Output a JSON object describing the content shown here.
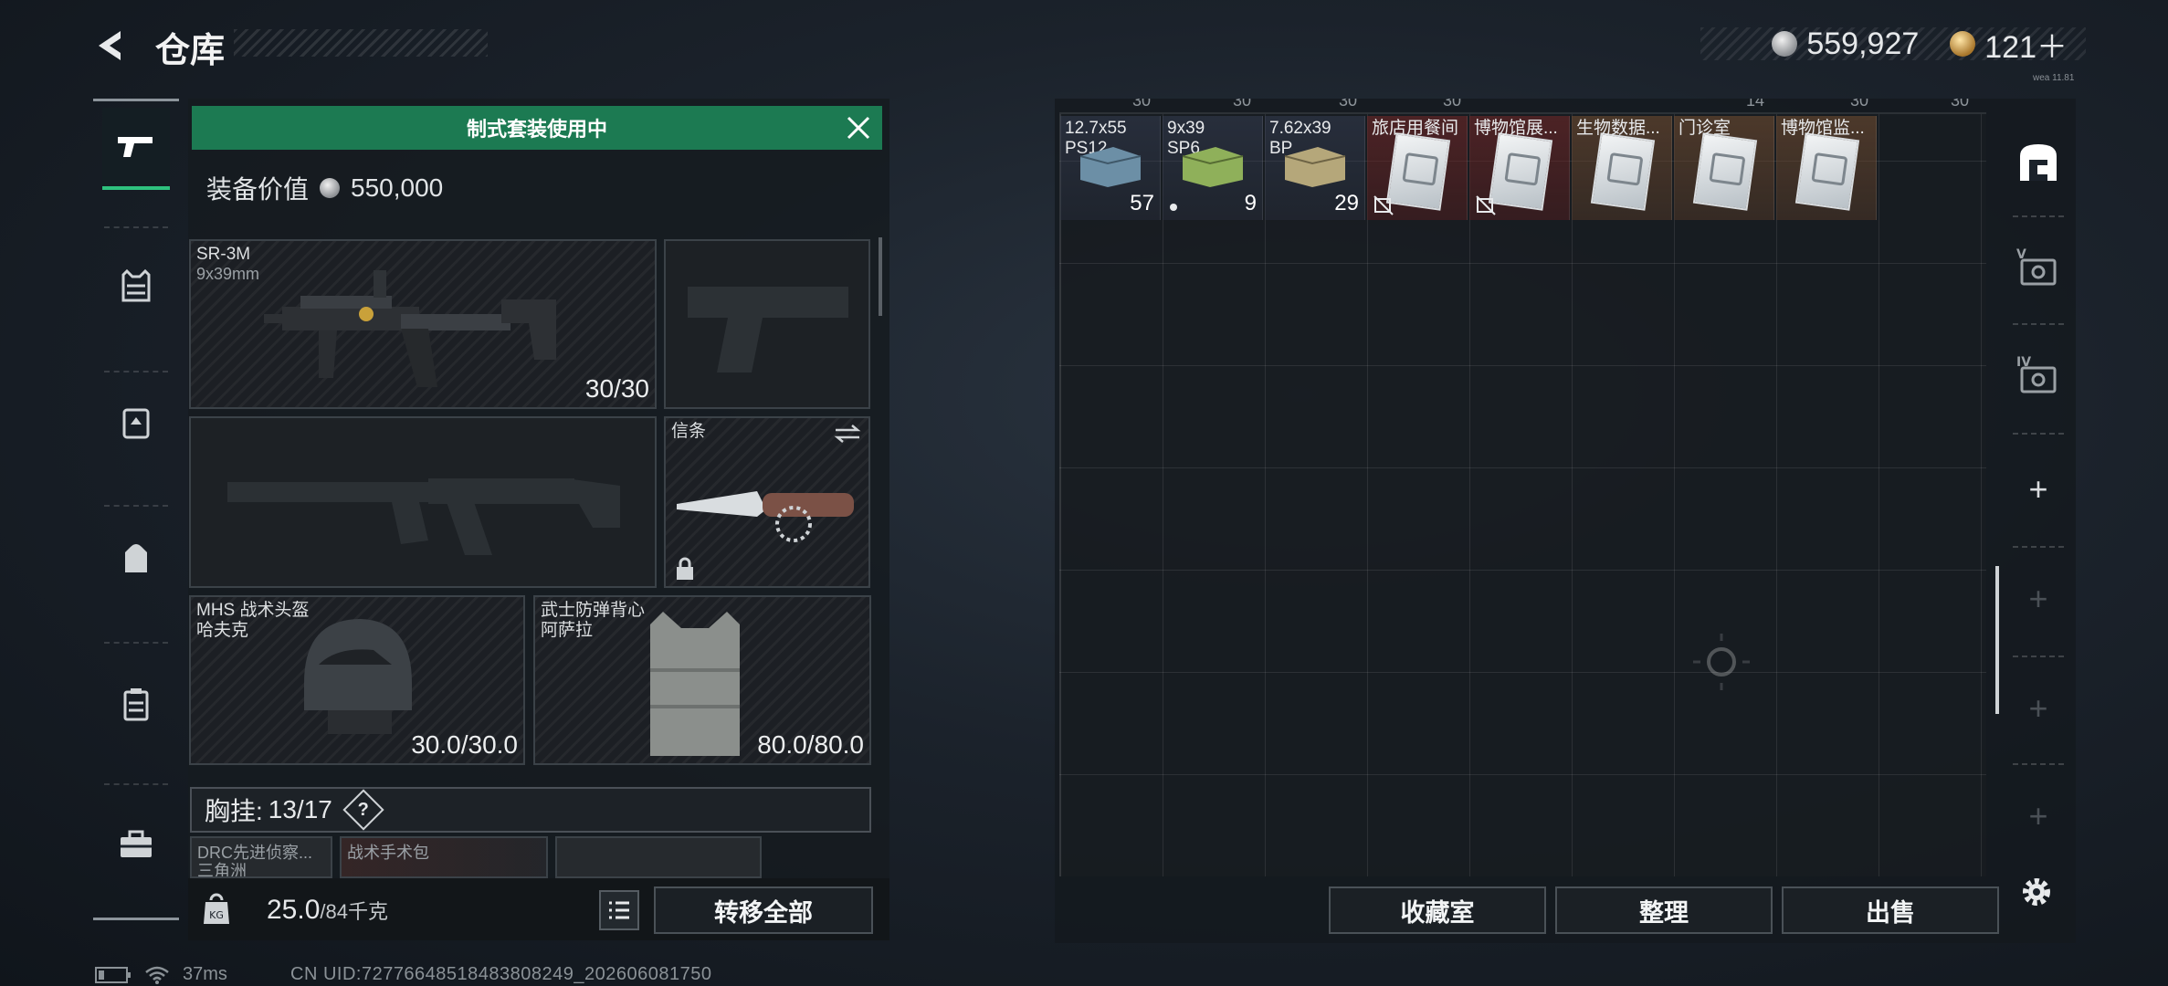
{
  "header": {
    "title": "仓库",
    "currency_silver": "559,927",
    "currency_gold": "121＋",
    "version": "wea 11.81"
  },
  "loadout": {
    "banner": "制式套装使用中",
    "equip_value_label": "装备价值",
    "equip_value": "550,000",
    "primary": {
      "name": "SR-3M",
      "caliber": "9x39mm",
      "ammo": "30/30"
    },
    "melee": {
      "name": "信条"
    },
    "helmet": {
      "name": "MHS 战术头盔",
      "sub": "哈夫克",
      "durability": "30.0/30.0"
    },
    "armor": {
      "name": "武士防弹背心",
      "sub": "阿萨拉",
      "durability": "80.0/80.0"
    },
    "chest_rig": {
      "label": "胸挂:",
      "count": "13/17",
      "help": "?"
    },
    "rig_slots": [
      {
        "name": "DRC先进侦察...",
        "sub": "三角洲"
      },
      {
        "name": "战术手术包"
      },
      {
        "name": ""
      }
    ],
    "weight": {
      "current": "25.0",
      "max": "/84千克"
    },
    "transfer_all": "转移全部"
  },
  "stash": {
    "top_row_hint": [
      "30",
      "30",
      "30",
      "30",
      "14",
      "30",
      "30"
    ],
    "items": [
      {
        "label1": "12.7x55",
        "label2": "PS12",
        "count": "57",
        "type": "ammo",
        "box_color": "#6c8fa6"
      },
      {
        "label1": "9x39",
        "label2": "SP6",
        "count": "9",
        "type": "ammo",
        "box_color": "#8fb05a"
      },
      {
        "label1": "7.62x39",
        "label2": "BP",
        "count": "29",
        "type": "ammo",
        "box_color": "#b5a77a"
      },
      {
        "label1": "旅店用餐间",
        "type": "key-red"
      },
      {
        "label1": "博物馆展...",
        "type": "key-red"
      },
      {
        "label1": "生物数据...",
        "type": "key-orange"
      },
      {
        "label1": "门诊室",
        "type": "key-orange"
      },
      {
        "label1": "博物馆监...",
        "type": "key-orange"
      }
    ],
    "buttons": {
      "collection": "收藏室",
      "organize": "整理",
      "sell": "出售"
    }
  },
  "right_nav": {
    "items": [
      "stash-main-icon",
      "case-v-icon",
      "case-iv-icon",
      "plus",
      "plus",
      "plus",
      "plus"
    ],
    "tier_v": "V",
    "tier_iv": "IV",
    "plus": "+"
  },
  "statusbar": {
    "ping": "37ms",
    "uid": "CN UID:72776648518483808249_202606081750"
  },
  "colors": {
    "accent_green": "#1c7a52",
    "nav_active": "#2ec27e"
  }
}
